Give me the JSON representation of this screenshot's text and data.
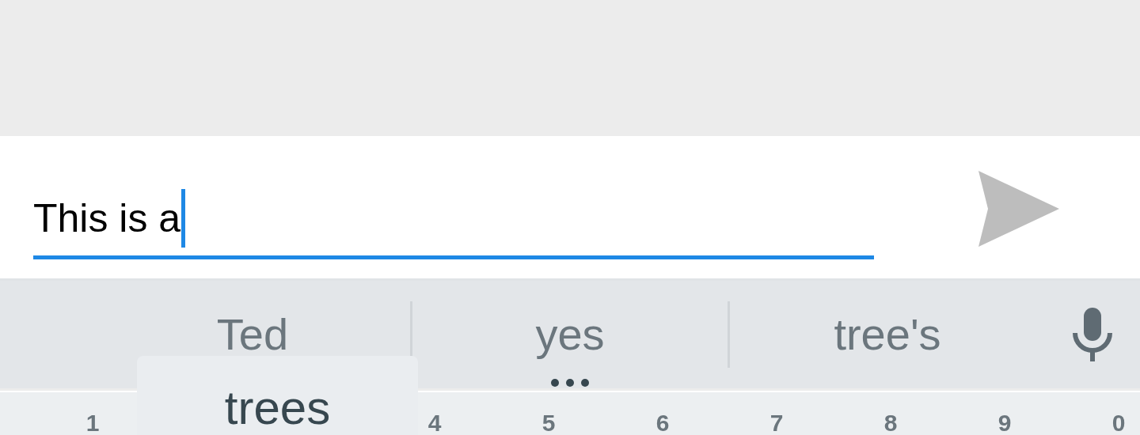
{
  "message_input": {
    "value": "This is a",
    "focused": true
  },
  "send_button": {
    "disabled": true
  },
  "suggestions": [
    {
      "text": "Ted",
      "has_more": false
    },
    {
      "text": "yes",
      "has_more": true
    },
    {
      "text": "tree's",
      "has_more": false
    }
  ],
  "key_preview": {
    "text": "trees"
  },
  "number_keys": [
    "1",
    "4",
    "5",
    "6",
    "7",
    "8",
    "9",
    "0"
  ]
}
